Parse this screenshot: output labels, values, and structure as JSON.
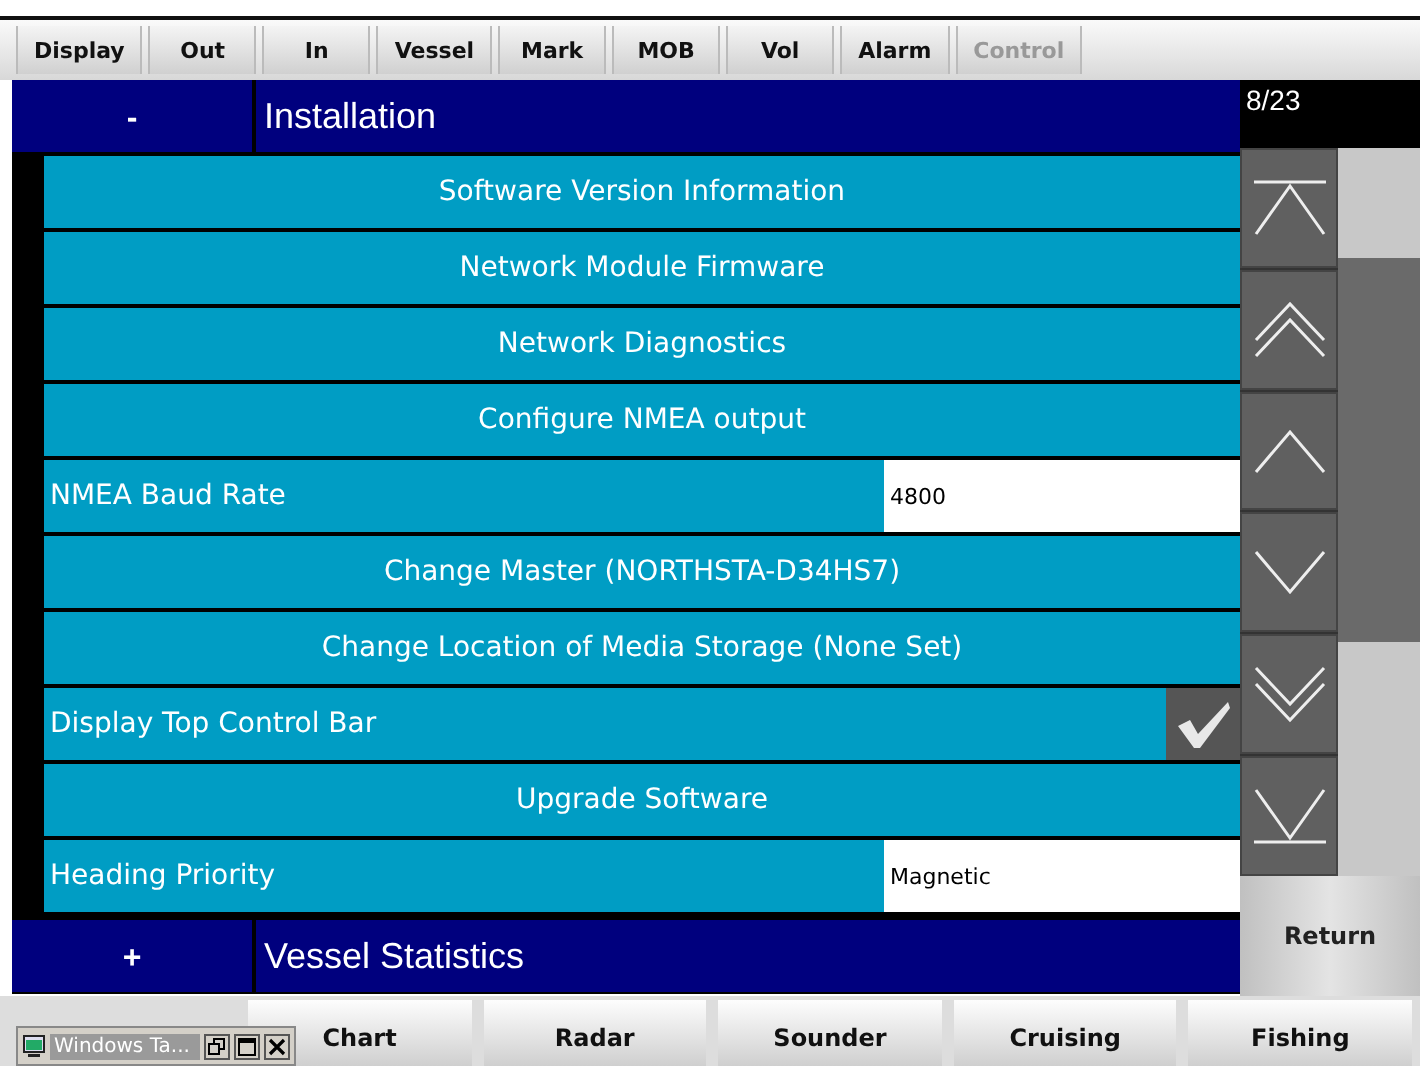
{
  "top_menu": [
    {
      "label": "Display",
      "disabled": false
    },
    {
      "label": "Out",
      "disabled": false
    },
    {
      "label": "In",
      "disabled": false
    },
    {
      "label": "Vessel",
      "disabled": false
    },
    {
      "label": "Mark",
      "disabled": false
    },
    {
      "label": "MOB",
      "disabled": false
    },
    {
      "label": "Vol",
      "disabled": false
    },
    {
      "label": "Alarm",
      "disabled": false
    },
    {
      "label": "Control",
      "disabled": true
    }
  ],
  "section": {
    "toggle": "-",
    "title": "Installation"
  },
  "page_counter": "8/23",
  "rows": [
    {
      "kind": "action",
      "label": "Software Version Information"
    },
    {
      "kind": "action",
      "label": "Network Module Firmware"
    },
    {
      "kind": "action",
      "label": "Network Diagnostics"
    },
    {
      "kind": "action",
      "label": "Configure NMEA output"
    },
    {
      "kind": "value",
      "label": "NMEA Baud Rate",
      "value": "4800"
    },
    {
      "kind": "action",
      "label": "Change Master (NORTHSTA-D34HS7)"
    },
    {
      "kind": "action",
      "label": "Change Location of Media Storage (None Set)"
    },
    {
      "kind": "toggle",
      "label": "Display Top Control Bar",
      "checked": true
    },
    {
      "kind": "action",
      "label": "Upgrade Software"
    },
    {
      "kind": "value",
      "label": "Heading Priority",
      "value": "Magnetic"
    }
  ],
  "next_section": {
    "toggle": "+",
    "title": "Vessel Statistics"
  },
  "return_button": "Return",
  "bottom_tabs": [
    "Chart",
    "Radar",
    "Sounder",
    "Cruising",
    "Fishing"
  ],
  "minimized_window": {
    "title": "Windows Ta..."
  }
}
